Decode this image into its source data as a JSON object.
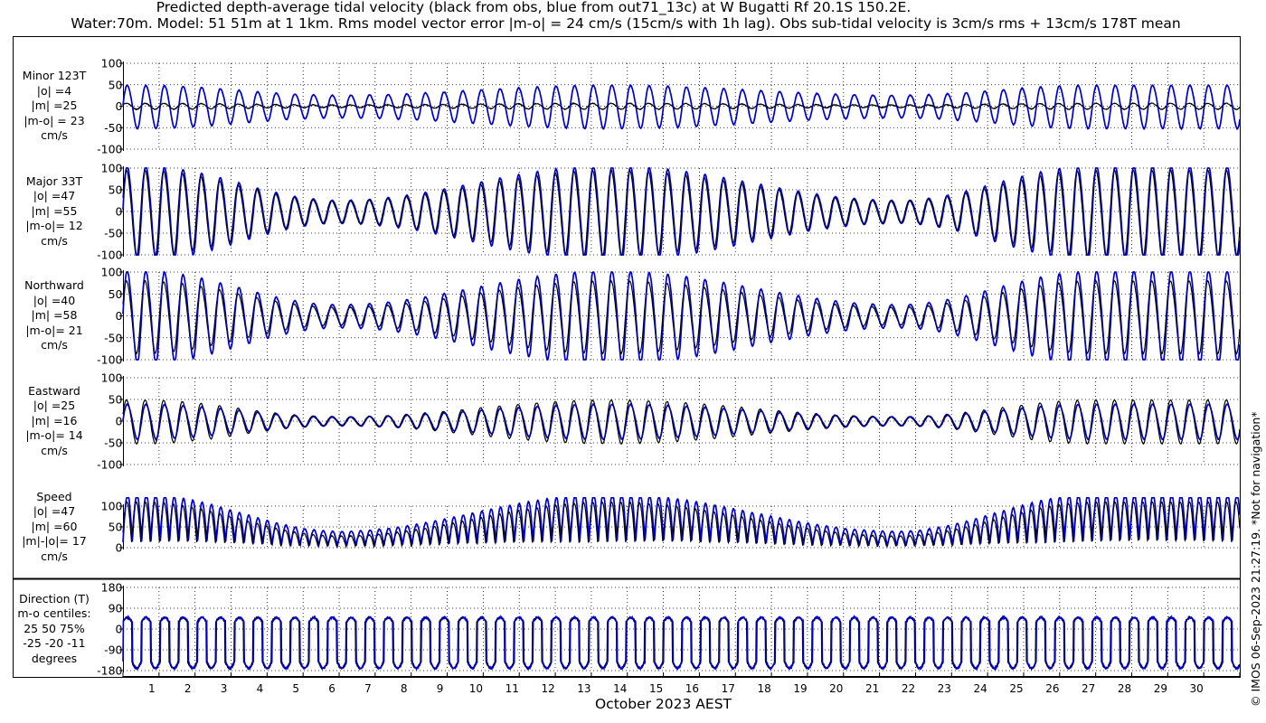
{
  "title_line1": "Predicted depth-average tidal velocity (black from obs, blue from out71_13c) at W Bugatti Rf 20.1S 150.2E.",
  "title_line2": "Water:70m. Model: 51 51m at 1 1km. Rms model vector error |m-o| = 24 cm/s (15cm/s with 1h lag). Obs sub-tidal velocity is 3cm/s rms + 13cm/s 178T mean",
  "credit": "© IMOS 06-Sep-2023 21:27:19. *Not for navigation*",
  "colors": {
    "obs": "#000000",
    "model": "#0000cc"
  },
  "chart_data": {
    "type": "line",
    "xlabel": "October 2023 AEST",
    "x_ticks": [
      "1",
      "2",
      "3",
      "4",
      "5",
      "6",
      "7",
      "8",
      "9",
      "10",
      "11",
      "12",
      "13",
      "14",
      "15",
      "16",
      "17",
      "18",
      "19",
      "20",
      "21",
      "22",
      "23",
      "24",
      "25",
      "26",
      "27",
      "28",
      "29",
      "30"
    ],
    "x_range_days": [
      0.0,
      31.0
    ],
    "series_legend": {
      "obs": "black from obs",
      "model": "blue from out71_13c"
    },
    "panels": [
      {
        "id": "minor",
        "label_lines": [
          "Minor 123T",
          "|o| =4",
          "|m| =25",
          "|m-o| = 23",
          "cm/s"
        ],
        "yticks": [
          "100",
          "50",
          "0",
          "-50",
          "-100"
        ],
        "ylim": [
          -100,
          100
        ],
        "grid": true,
        "kind": "velocity",
        "obs_amp_range": [
          3,
          7
        ],
        "model_amp_range": [
          26,
          50
        ]
      },
      {
        "id": "major",
        "label_lines": [
          "Major 33T",
          "|o| =47",
          "|m| =55",
          "|m-o|= 12",
          "cm/s"
        ],
        "yticks": [
          "100",
          "50",
          "0",
          "-50",
          "-100"
        ],
        "ylim": [
          -100,
          100
        ],
        "grid": true,
        "kind": "velocity",
        "obs_amp_range": [
          25,
          98
        ],
        "model_amp_range": [
          26,
          108
        ]
      },
      {
        "id": "northward",
        "label_lines": [
          "Northward",
          "|o| =40",
          "|m| =58",
          "|m-o|= 21",
          "cm/s"
        ],
        "yticks": [
          "100",
          "50",
          "0",
          "-50",
          "-100"
        ],
        "ylim": [
          -100,
          100
        ],
        "grid": true,
        "kind": "velocity",
        "obs_amp_range": [
          20,
          82
        ],
        "model_amp_range": [
          26,
          105
        ]
      },
      {
        "id": "eastward",
        "label_lines": [
          "Eastward",
          "|o| =25",
          "|m| =16",
          "|m-o|= 14",
          "cm/s"
        ],
        "yticks": [
          "100",
          "50",
          "0",
          "-50",
          "-100"
        ],
        "ylim": [
          -100,
          100
        ],
        "grid": true,
        "kind": "velocity",
        "obs_amp_range": [
          10,
          50
        ],
        "model_amp_range": [
          10,
          40
        ]
      },
      {
        "id": "speed",
        "label_lines": [
          "Speed",
          "|o| =47",
          "|m| =60",
          "|m|-|o|= 17",
          "cm/s"
        ],
        "yticks": [
          "100",
          "50",
          "0"
        ],
        "ylim": [
          0,
          120
        ],
        "grid": true,
        "kind": "speed",
        "obs_amp_range": [
          25,
          98
        ],
        "model_amp_range": [
          35,
          115
        ]
      },
      {
        "id": "direction",
        "label_lines": [
          "Direction (T)",
          "m-o centiles:",
          "25  50  75%",
          "-25 -20 -11",
          "degrees"
        ],
        "yticks": [
          "180",
          "90",
          "0",
          "-90",
          "-180"
        ],
        "ylim": [
          -180,
          180
        ],
        "grid": true,
        "kind": "direction",
        "centiles_percent": [
          25,
          50,
          75
        ],
        "centile_values_deg": [
          -25,
          -20,
          -11
        ]
      }
    ],
    "tidal_period_hours": 12.42,
    "spring_neap_minima_day": [
      6.0,
      21.5
    ],
    "spring_maxima_day": [
      0.5,
      13.5,
      27.0
    ]
  }
}
